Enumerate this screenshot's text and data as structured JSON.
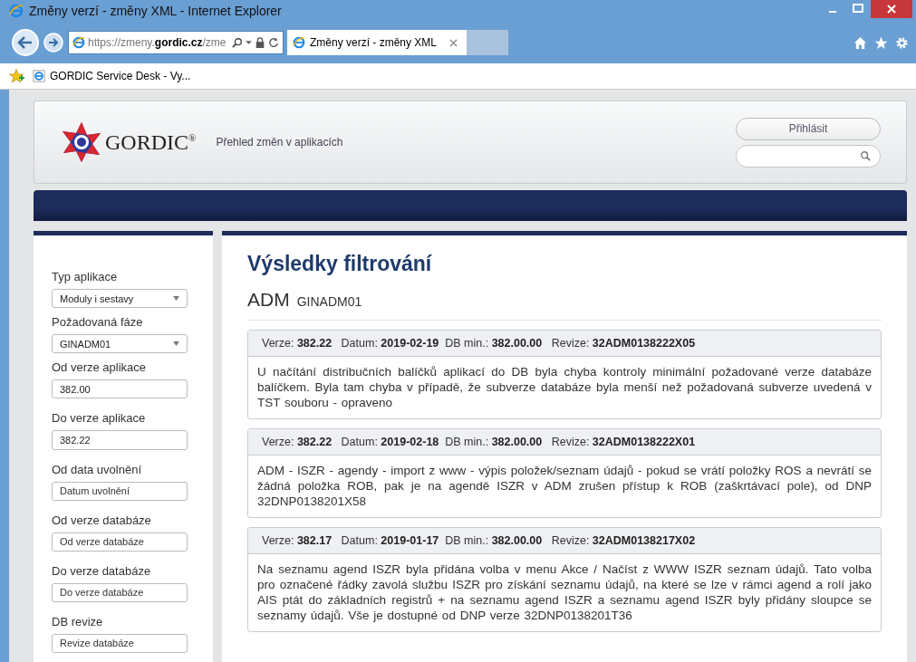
{
  "window": {
    "title": "Změny verzí - změny XML - Internet Explorer"
  },
  "address_bar": {
    "url_prefix": "https://zmeny.",
    "url_domain": "gordic.cz",
    "url_rest": "/zme"
  },
  "tabs": [
    {
      "label": "Změny verzí - změny XML",
      "selected": true
    }
  ],
  "favorites_bar": {
    "items": [
      "GORDIC Service Desk - Vy..."
    ]
  },
  "header": {
    "logo_text": "GORDIC",
    "logo_mark": "®",
    "subtitle": "Přehled změn v aplikacích",
    "login_button": "Přihlásit"
  },
  "filters": [
    {
      "label": "Typ aplikace",
      "kind": "select",
      "value": "Moduly i sestavy"
    },
    {
      "label": "Požadovaná fáze",
      "kind": "select",
      "value": "GINADM01"
    },
    {
      "label": "Od verze aplikace",
      "kind": "input",
      "value": "382.00"
    },
    {
      "label": "Do verze aplikace",
      "kind": "input",
      "value": "382.22"
    },
    {
      "label": "Od data uvolnění",
      "kind": "input",
      "placeholder": "Datum uvolnění"
    },
    {
      "label": "Od verze databáze",
      "kind": "input",
      "placeholder": "Od verze databáze"
    },
    {
      "label": "Do verze databáze",
      "kind": "input",
      "placeholder": "Do verze databáze"
    },
    {
      "label": "DB revize",
      "kind": "input",
      "placeholder": "Revize databáze"
    }
  ],
  "results": {
    "title": "Výsledky filtrování",
    "module": "ADM",
    "phase": "GINADM01",
    "entries": [
      {
        "header": "Verze: **382.22**   Datum: **2019-02-19**  DB min.: **382.00.00**   Revize: **32ADM0138222X05**",
        "text": "U načítání distribučních balíčků aplikací do DB byla chyba kontroly minimální požadované verze databáze balíčkem. Byla tam chyba v případě, že subverze databáze byla menší než požadovaná subverze uvedená v TST souboru - opraveno"
      },
      {
        "header": "Verze: **382.22**   Datum: **2019-02-18**  DB min.: **382.00.00**   Revize: **32ADM0138222X01**",
        "text": "ADM - ISZR - agendy - import z www - výpis položek/seznam údajů - pokud se vrátí položky ROS a nevrátí se žádná položka ROB, pak je na agendě ISZR v ADM zrušen přístup k ROB (zaškrtávací pole), od DNP 32DNP0138201X58"
      },
      {
        "header": "Verze: **382.17**   Datum: **2019-01-17**  DB min.: **382.00.00**   Revize: **32ADM0138217X02**",
        "text": "Na seznamu agend ISZR byla přidána volba v menu Akce / Načíst z WWW ISZR seznam údajů. Tato volba pro označené řádky zavolá službu ISZR pro získání seznamu údajů, na které se lze v rámci agend a rolí jako AIS ptát do základních registrů + na seznamu agend ISZR a seznamu agend ISZR byly přidány sloupce se seznamy údajů. Vše je dostupné od DNP verze 32DNP0138201T36"
      }
    ]
  }
}
